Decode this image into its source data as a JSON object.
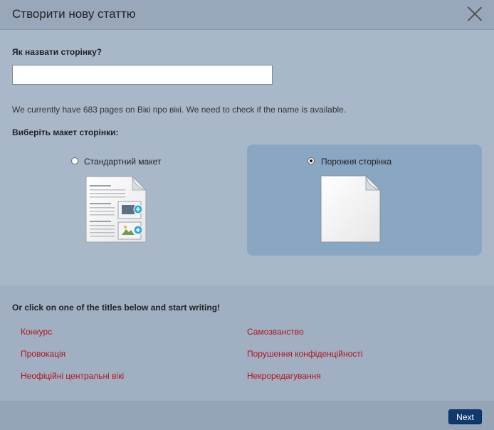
{
  "dialog": {
    "title": "Створити нову статтю",
    "close_icon": "close-icon"
  },
  "form": {
    "name_label": "Як назвати сторінку?",
    "name_value": "",
    "name_placeholder": "",
    "info_text": "We currently have 683 pages on Вікі про вікі. We need to check if the name is available.",
    "layout_label": "Виберіть макет сторінки:"
  },
  "layouts": [
    {
      "label": "Стандартний макет",
      "selected": false,
      "icon": "standard-layout-icon"
    },
    {
      "label": "Порожня сторінка",
      "selected": true,
      "icon": "blank-page-icon"
    }
  ],
  "suggestions": {
    "heading": "Or click on one of the titles below and start writing!",
    "titles": [
      "Конкурс",
      "Самозванство",
      "Провокація",
      "Порушення конфіденційності",
      "Неофіційні центральні вікі",
      "Некроредагування"
    ],
    "link_color": "#b5121b"
  },
  "footer": {
    "next_label": "Next",
    "next_color": "#0f3a6e"
  },
  "colors": {
    "selected_panel": "#89a6c2",
    "background": "#a9b8c9"
  }
}
